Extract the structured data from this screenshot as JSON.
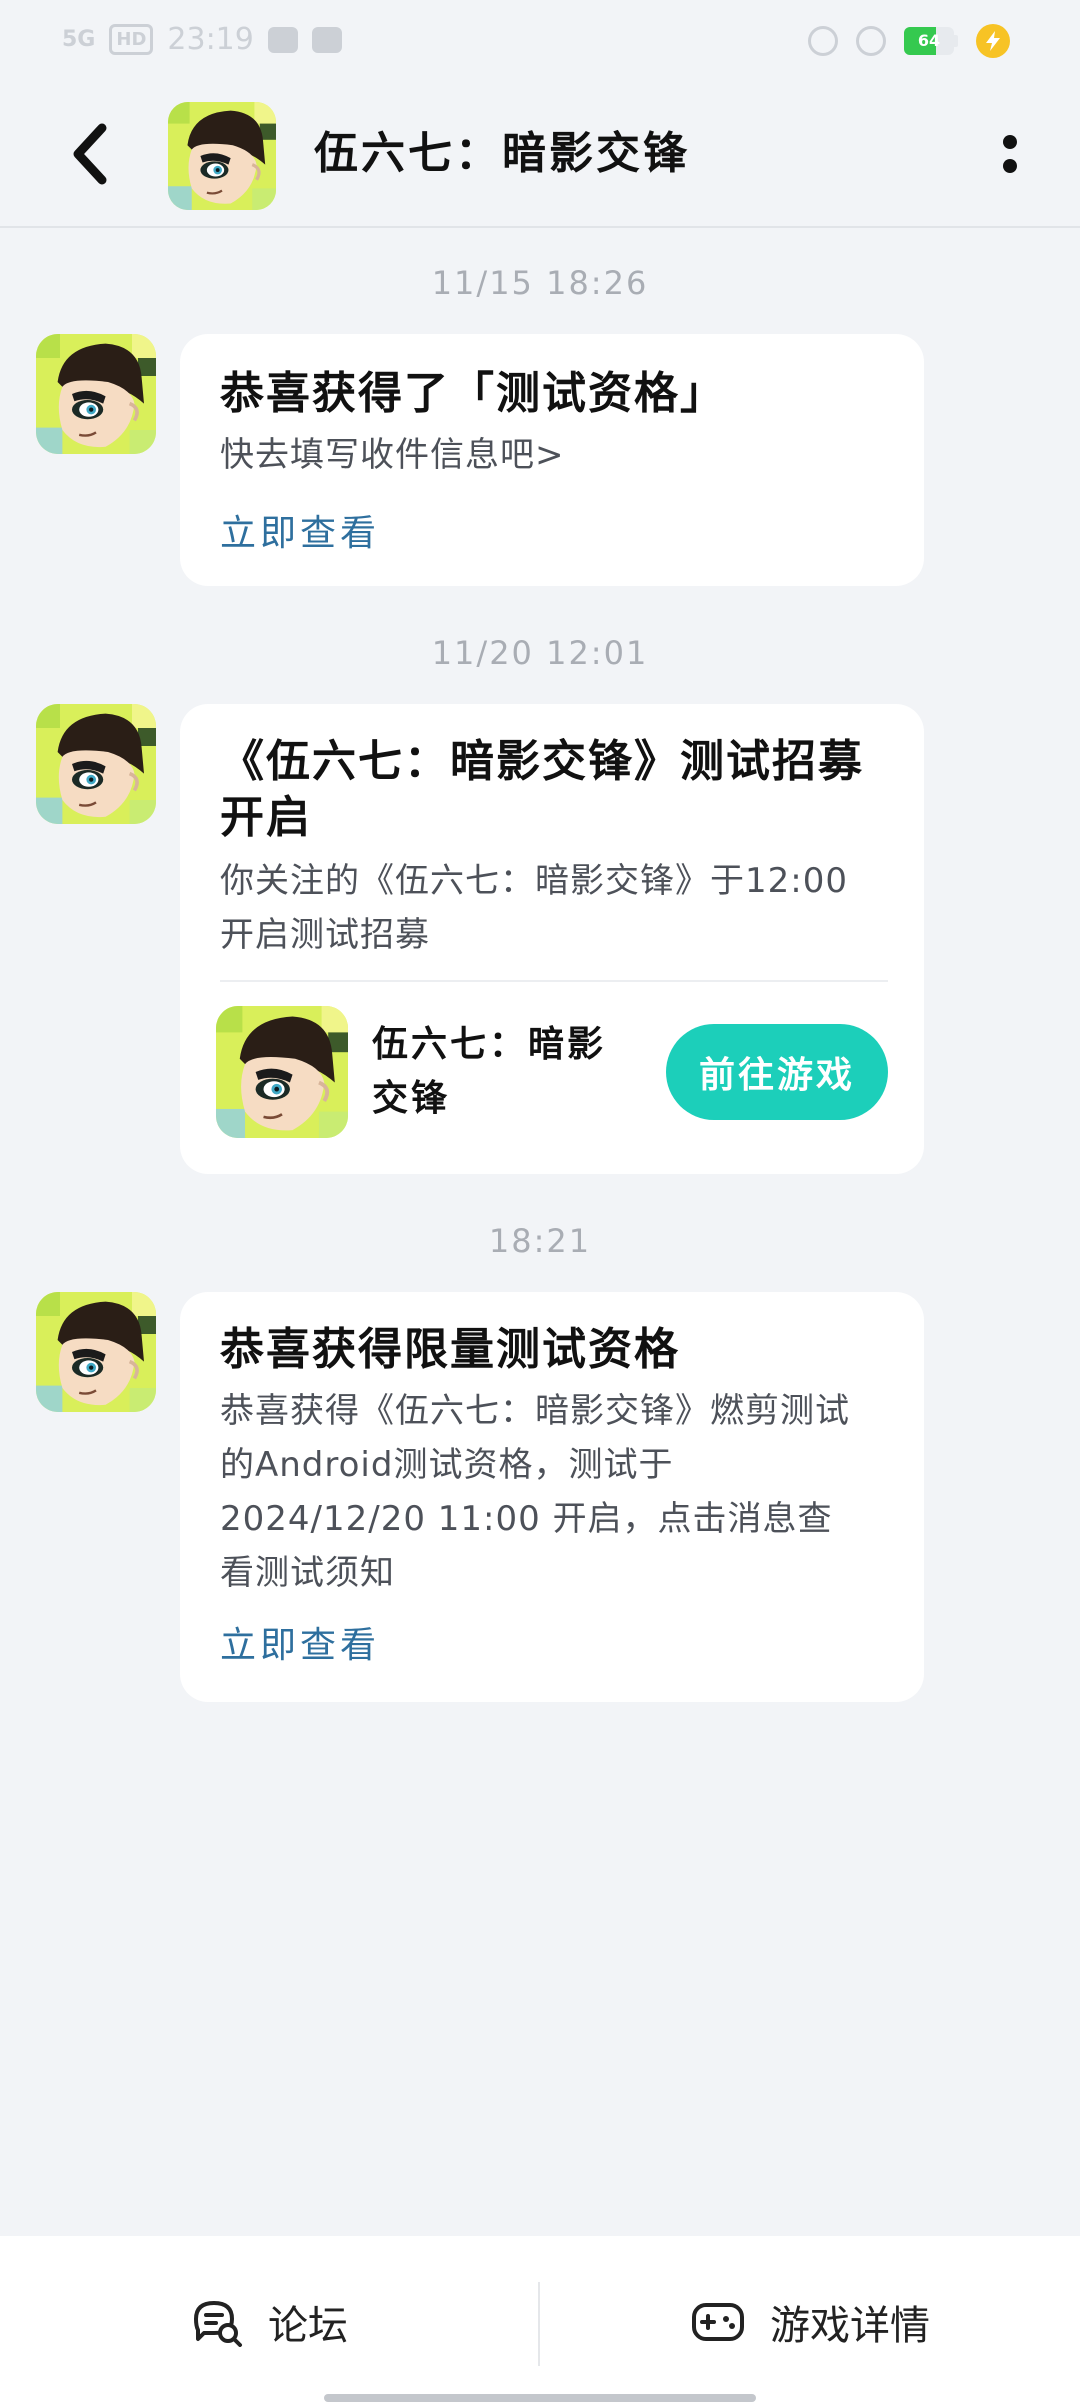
{
  "status_bar": {
    "network": "5G",
    "hd_badge": "HD",
    "time": "23:19",
    "battery_level": 64,
    "battery_text": "64"
  },
  "header": {
    "title": "伍六七：暗影交锋",
    "back_icon": "chevron-left-icon",
    "more_icon": "more-vertical-icon"
  },
  "messages": [
    {
      "time": "11/15 18:26",
      "title": "恭喜获得了「测试资格」",
      "body": "快去填写收件信息吧>",
      "link": "立即查看"
    },
    {
      "time": "11/20 12:01",
      "title": "《伍六七：暗影交锋》测试招募开启",
      "body": "你关注的《伍六七：暗影交锋》于12:00 开启测试招募",
      "game_name": "伍六七：暗影交锋",
      "button": "前往游戏"
    },
    {
      "time": "18:21",
      "title": "恭喜获得限量测试资格",
      "body": "恭喜获得《伍六七：暗影交锋》燃剪测试的Android测试资格，测试于2024/12/20 11:00 开启，点击消息查看测试须知",
      "link": "立即查看"
    }
  ],
  "bottom_nav": {
    "forum_label": "论坛",
    "forum_icon": "chat-search-icon",
    "details_label": "游戏详情",
    "details_icon": "gamepad-icon"
  },
  "colors": {
    "accent": "#1ccfba",
    "link": "#2e6f9e",
    "background": "#f2f4f7"
  }
}
